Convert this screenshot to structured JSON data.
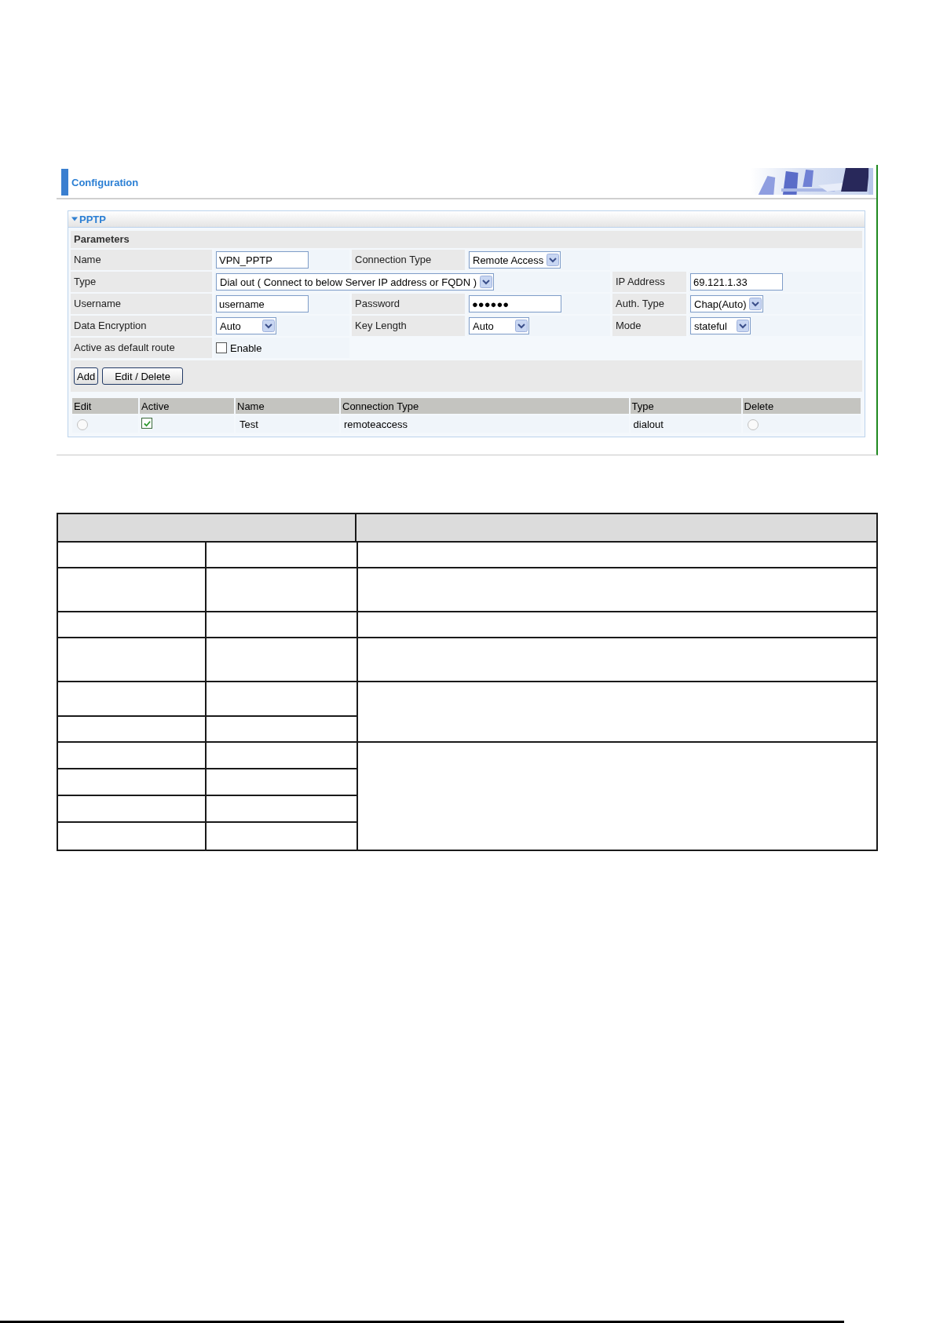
{
  "header": {
    "title": "Configuration"
  },
  "panel": {
    "title": "PPTP",
    "expanded": true,
    "section": "Parameters",
    "rows": [
      {
        "cells": [
          {
            "kind": "label",
            "text": "Name"
          },
          {
            "kind": "text",
            "value": "VPN_PPTP"
          },
          {
            "kind": "label",
            "text": "Connection Type"
          },
          {
            "kind": "dropdown",
            "value": "Remote Access"
          }
        ]
      },
      {
        "cells": [
          {
            "kind": "label",
            "text": "Type"
          },
          {
            "kind": "dropdown",
            "value": "Dial out ( Connect to below Server IP address or FQDN )",
            "colspan": 3
          },
          {
            "kind": "label",
            "text": "IP Address"
          },
          {
            "kind": "text",
            "value": "69.121.1.33"
          }
        ]
      },
      {
        "cells": [
          {
            "kind": "label",
            "text": "Username"
          },
          {
            "kind": "text",
            "value": "username"
          },
          {
            "kind": "label",
            "text": "Password"
          },
          {
            "kind": "text",
            "value": "●●●●●●"
          },
          {
            "kind": "label",
            "text": "Auth. Type"
          },
          {
            "kind": "dropdown",
            "value": "Chap(Auto)"
          }
        ]
      },
      {
        "cells": [
          {
            "kind": "label",
            "text": "Data Encryption"
          },
          {
            "kind": "dropdown",
            "value": "Auto"
          },
          {
            "kind": "label",
            "text": "Key Length"
          },
          {
            "kind": "dropdown",
            "value": "Auto"
          },
          {
            "kind": "label",
            "text": "Mode"
          },
          {
            "kind": "dropdown",
            "value": "stateful"
          }
        ]
      },
      {
        "cells": [
          {
            "kind": "label",
            "text": "Active as default route"
          },
          {
            "kind": "checkbox",
            "label": "Enable",
            "checked": false
          }
        ]
      }
    ],
    "buttons": [
      "Add",
      "Edit / Delete"
    ],
    "table": {
      "columns": [
        "Edit",
        "Active",
        "Name",
        "Connection Type",
        "Type",
        "Delete"
      ],
      "rows": [
        {
          "edit_selected": false,
          "active": true,
          "name": "Test",
          "connection_type": "remoteaccess",
          "type": "dialout",
          "delete_selected": false
        }
      ]
    }
  }
}
